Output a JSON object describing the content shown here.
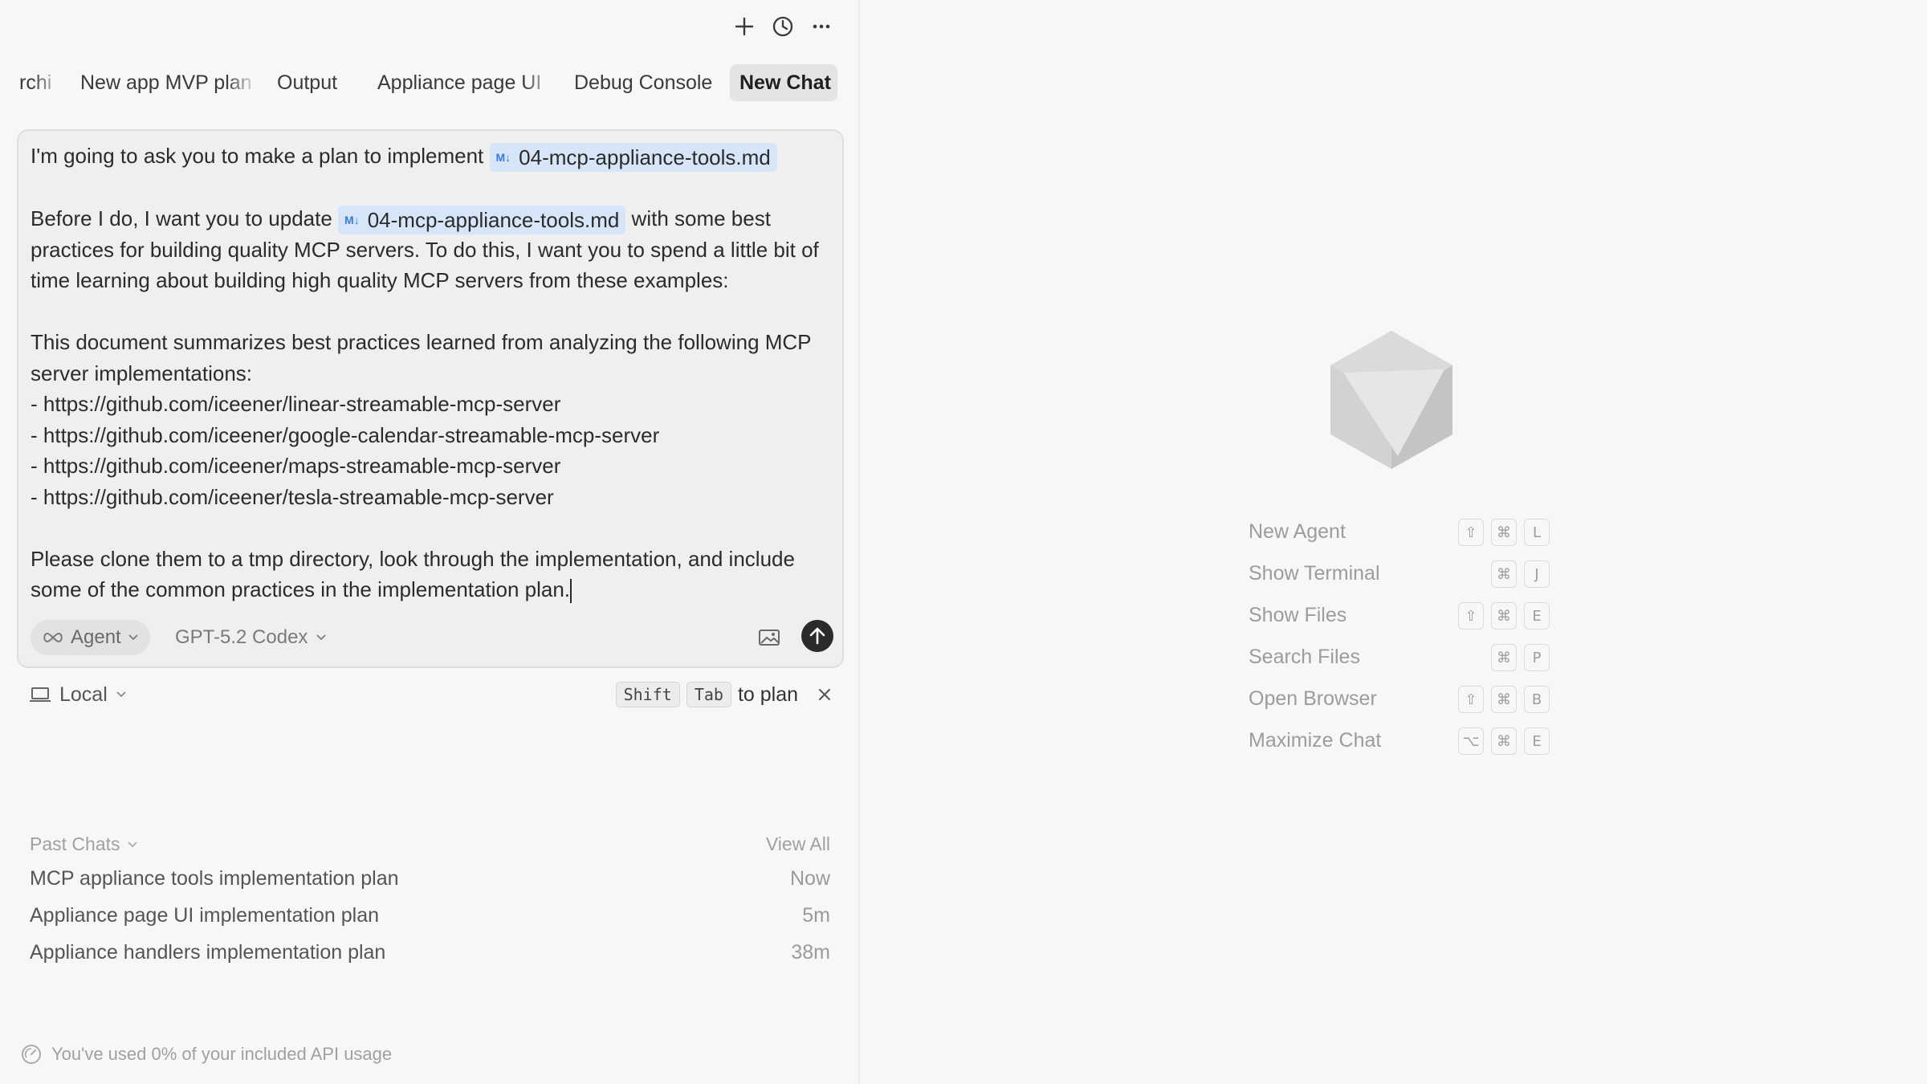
{
  "tabs": [
    {
      "label": "rchi"
    },
    {
      "label": "New app MVP plan"
    },
    {
      "label": "Output"
    },
    {
      "label": "Appliance page UI"
    },
    {
      "label": "Debug Console"
    },
    {
      "label": "New Chat",
      "active": true
    }
  ],
  "composer": {
    "line1_prefix": "I'm going to ask you to make a plan to implement",
    "file_chip": "04-mcp-appliance-tools.md",
    "para2_prefix": "Before I do, I want you to update",
    "para2_suffix": "with some best practices for building quality MCP servers. To do this, I want you to spend a little bit of time learning about building high quality MCP servers from these examples:",
    "para3": "This document summarizes best practices learned from analyzing the following MCP server implementations:",
    "links": [
      "- https://github.com/iceener/linear-streamable-mcp-server",
      "- https://github.com/iceener/google-calendar-streamable-mcp-server",
      "- https://github.com/iceener/maps-streamable-mcp-server",
      "- https://github.com/iceener/tesla-streamable-mcp-server"
    ],
    "para4": "Please clone them to a tmp directory, look through the implementation, and include some of the common practices in the implementation plan.",
    "agent_label": "Agent",
    "model_label": "GPT-5.2 Codex"
  },
  "below": {
    "local_label": "Local",
    "key_shift": "Shift",
    "key_tab": "Tab",
    "hint_suffix": "to plan"
  },
  "past_chats": {
    "header": "Past Chats",
    "view_all": "View All",
    "items": [
      {
        "title": "MCP appliance tools implementation plan",
        "time": "Now"
      },
      {
        "title": "Appliance page UI implementation plan",
        "time": "5m"
      },
      {
        "title": "Appliance handlers implementation plan",
        "time": "38m"
      }
    ]
  },
  "usage": "You've used 0% of your included API usage",
  "shortcuts": [
    {
      "label": "New Agent",
      "keys": [
        "⇧",
        "⌘",
        "L"
      ]
    },
    {
      "label": "Show Terminal",
      "keys": [
        "⌘",
        "J"
      ]
    },
    {
      "label": "Show Files",
      "keys": [
        "⇧",
        "⌘",
        "E"
      ]
    },
    {
      "label": "Search Files",
      "keys": [
        "⌘",
        "P"
      ]
    },
    {
      "label": "Open Browser",
      "keys": [
        "⇧",
        "⌘",
        "B"
      ]
    },
    {
      "label": "Maximize Chat",
      "keys": [
        "⌥",
        "⌘",
        "E"
      ]
    }
  ],
  "colors": {
    "chip_bg": "#d6e5f7",
    "send_bg": "#2b2b2b",
    "accent_blue": "#3b7ad8"
  }
}
